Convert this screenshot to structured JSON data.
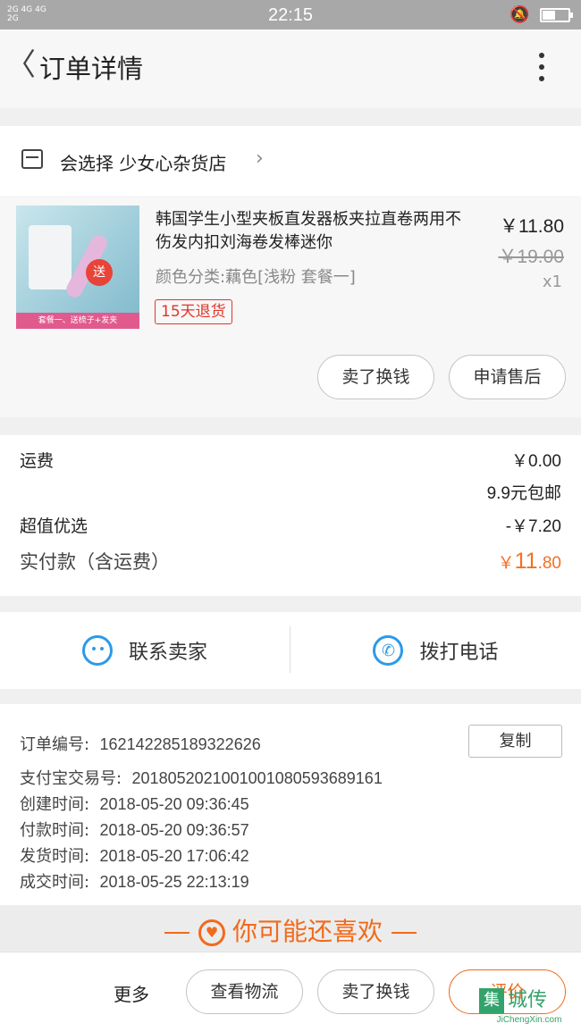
{
  "status_bar": {
    "signal": "2G 4G 4G\n2G",
    "time": "22:15",
    "battery_level": 0.5
  },
  "header": {
    "title": "订单详情"
  },
  "shop": {
    "name": "会选择 少女心杂货店"
  },
  "product": {
    "name": "韩国学生小型夹板直发器板夹拉直卷两用不伤发内扣刘海卷发棒迷你",
    "variant": "颜色分类:藕色[浅粉 套餐一]",
    "refund_tag": "15天退货",
    "price": "￥11.80",
    "original_price": "￥19.00",
    "quantity": "x1",
    "thumb_sale": "送",
    "thumb_caption": "套餐一、送梳子+发夹",
    "actions": [
      "卖了换钱",
      "申请售后"
    ]
  },
  "fees": {
    "shipping_label": "运费",
    "shipping_value": "￥0.00",
    "shipping_note": "9.9元包邮",
    "discount_label": "超值优选",
    "discount_value": "-￥7.20",
    "paid_label": "实付款（含运费）",
    "paid_currency": "￥",
    "paid_int": "11",
    "paid_dec": ".80"
  },
  "contact": {
    "seller_label": "联系卖家",
    "phone_label": "拨打电话"
  },
  "order": {
    "copy_label": "复制",
    "rows": [
      {
        "label": "订单编号:",
        "value": "162142285189322626"
      },
      {
        "label": "支付宝交易号:",
        "value": "2018052021001001080593689161"
      },
      {
        "label": "创建时间:",
        "value": "2018-05-20 09:36:45"
      },
      {
        "label": "付款时间:",
        "value": "2018-05-20 09:36:57"
      },
      {
        "label": "发货时间:",
        "value": "2018-05-20 17:06:42"
      },
      {
        "label": "成交时间:",
        "value": "2018-05-25 22:13:19"
      }
    ]
  },
  "recommend": {
    "title": "你可能还喜欢"
  },
  "bottom_bar": {
    "more_label": "更多",
    "buttons": [
      "查看物流",
      "卖了换钱",
      "评价"
    ]
  },
  "watermark": {
    "badge": "集",
    "name": "城传",
    "url": "JiChengXin.com"
  },
  "colors": {
    "accent_orange": "#f26a1b",
    "blue": "#2b9ae8",
    "red": "#e0352b"
  }
}
